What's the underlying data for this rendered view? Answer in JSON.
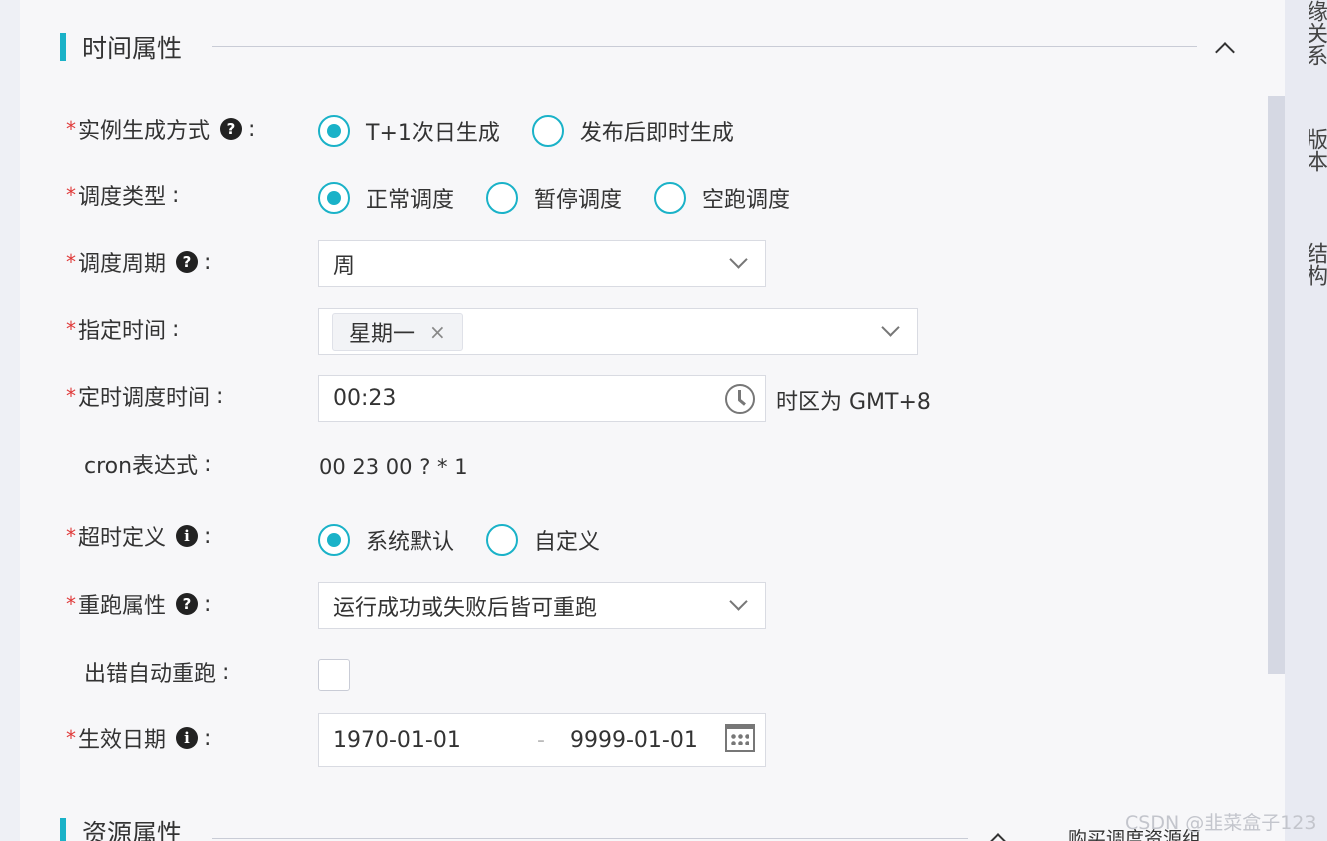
{
  "right_rail": {
    "items": [
      "缘关系",
      "版本",
      "结构"
    ]
  },
  "time_section": {
    "title": "时间属性"
  },
  "resource_section": {
    "title": "资源属性",
    "action_text": "购买调度资源组"
  },
  "form": {
    "instance_mode": {
      "label": "实例生成方式",
      "options": [
        "T+1次日生成",
        "发布后即时生成"
      ],
      "selected_index": 0
    },
    "schedule_type": {
      "label": "调度类型",
      "options": [
        "正常调度",
        "暂停调度",
        "空跑调度"
      ],
      "selected_index": 0
    },
    "schedule_cycle": {
      "label": "调度周期",
      "value": "周"
    },
    "specified_time": {
      "label": "指定时间",
      "tags": [
        "星期一"
      ]
    },
    "timed_schedule_time": {
      "label": "定时调度时间",
      "value": "00:23",
      "timezone_note": "时区为 GMT+8"
    },
    "cron": {
      "label": "cron表达式",
      "value": "00 23 00 ? * 1"
    },
    "timeout": {
      "label": "超时定义",
      "options": [
        "系统默认",
        "自定义"
      ],
      "selected_index": 0
    },
    "rerun": {
      "label": "重跑属性",
      "value": "运行成功或失败后皆可重跑"
    },
    "auto_rerun_on_error": {
      "label": "出错自动重跑",
      "checked": false
    },
    "effective_date": {
      "label": "生效日期",
      "start": "1970-01-01",
      "separator": "-",
      "end": "9999-01-01"
    }
  },
  "common": {
    "required_mark": "*",
    "colon": ":",
    "help_glyph": "?",
    "info_glyph": "i",
    "tag_close": "×"
  },
  "watermark": "CSDN @韭菜盒子123",
  "colors": {
    "accent": "#1ab2c8",
    "required": "#e03a3a"
  }
}
